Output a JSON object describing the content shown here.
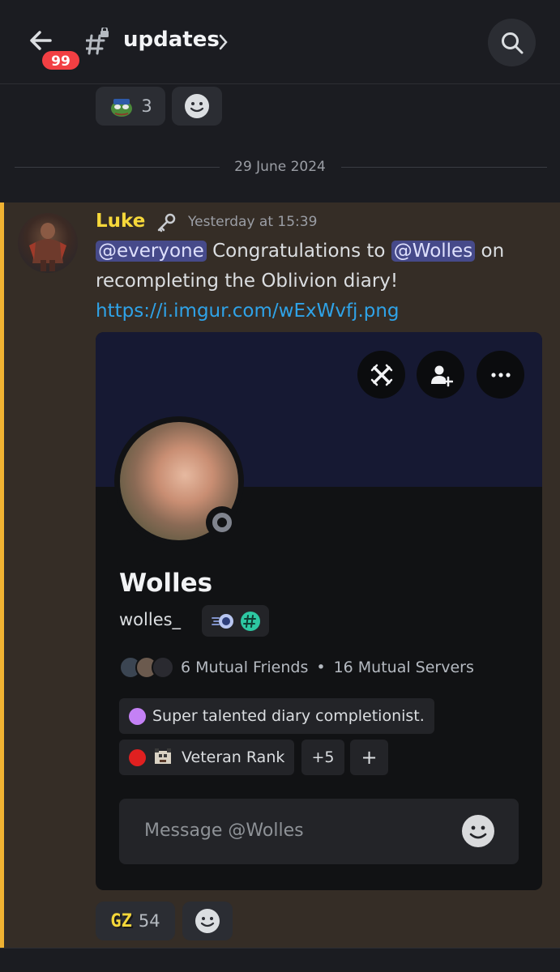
{
  "header": {
    "unread_badge": "99",
    "channel_name": "updates"
  },
  "top_reactions": [
    {
      "emoji": "pepe-emoji",
      "count": "3"
    },
    {
      "emoji": "add-reaction-icon",
      "count": ""
    }
  ],
  "date_divider": "29 June 2024",
  "message": {
    "author": "Luke",
    "timestamp": "Yesterday at 15:39",
    "mention_everyone": "@everyone",
    "text_1": " Congratulations to ",
    "mention_user": "@Wolles",
    "text_2": " on recompleting the Oblivion diary!",
    "link": "https://i.imgur.com/wExWvfj.png"
  },
  "profile_card": {
    "display_name": "Wolles",
    "username": "wolles_",
    "mutual_friends": "6 Mutual Friends",
    "separator": "•",
    "mutual_servers": "16 Mutual Servers",
    "role_1": "Super talented diary completionist.",
    "role_2": "Veteran Rank",
    "more_roles": "+5",
    "add_role": "+",
    "message_placeholder": "Message @Wolles",
    "colors": {
      "role_1_dot": "#c481f5",
      "role_2_dot": "#e02020"
    }
  },
  "bottom_reactions": [
    {
      "emoji_text": "GZ",
      "count": "54"
    },
    {
      "emoji": "add-reaction-icon",
      "count": ""
    }
  ],
  "colors": {
    "highlight_bar": "#f0b232",
    "author_color": "#f5d73a",
    "link_color": "#2fa3e8",
    "badge_red": "#f23f43"
  }
}
